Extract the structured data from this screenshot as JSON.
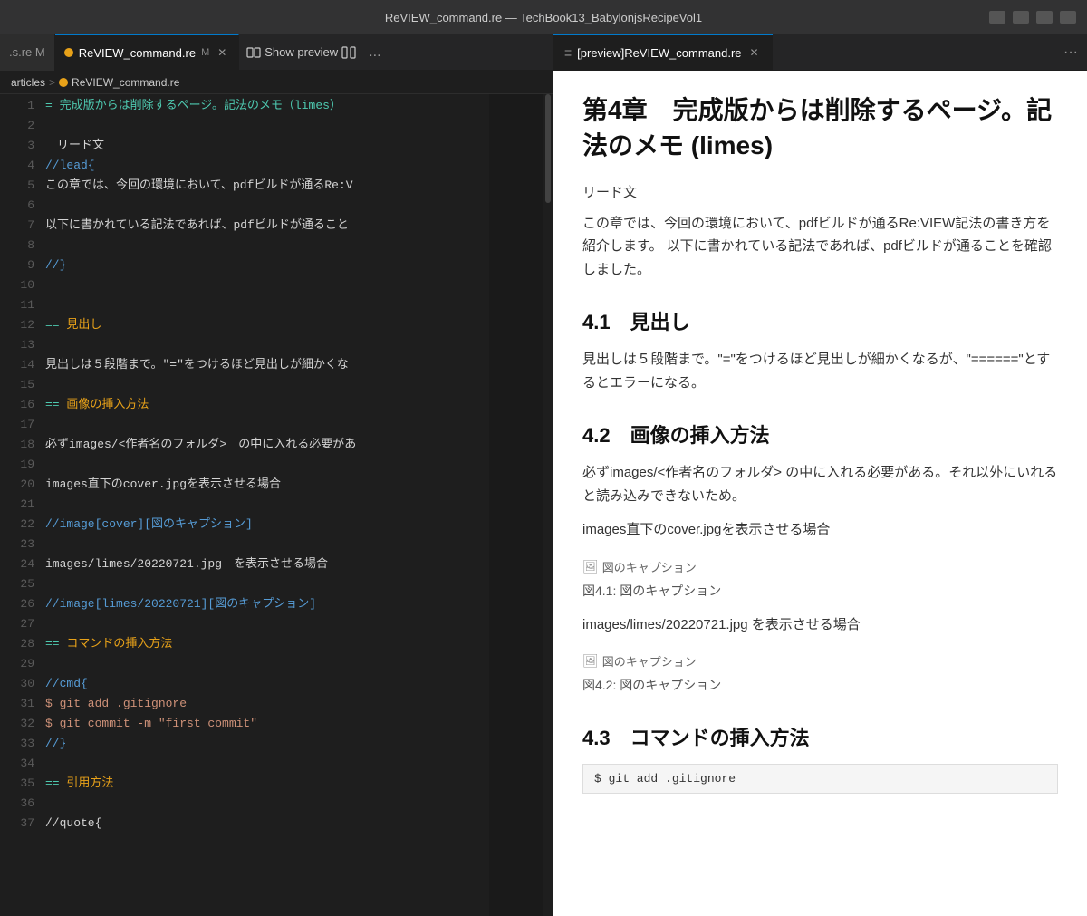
{
  "titleBar": {
    "title": "ReVIEW_command.re — TechBook13_BabylonjsRecipeVol1"
  },
  "tabBar": {
    "tabs": [
      {
        "id": "tab-review-short",
        "label": ".s.re",
        "dot": true,
        "modified": true,
        "active": false,
        "showClose": false
      },
      {
        "id": "tab-review-command",
        "label": "ReVIEW_command.re",
        "dot": true,
        "modified": true,
        "active": true,
        "showClose": true
      }
    ],
    "showPreviewLabel": "Show preview",
    "overflowLabel": "..."
  },
  "breadcrumb": {
    "folder": "articles",
    "separator": ">",
    "filename": "ReVIEW_command.re"
  },
  "editor": {
    "lines": [
      {
        "num": 1,
        "content": "= 完成版からは削除するページ。記法のメモ（limes）",
        "type": "heading"
      },
      {
        "num": 2,
        "content": ""
      },
      {
        "num": 3,
        "content": "　リード文"
      },
      {
        "num": 4,
        "content": "//lead{",
        "type": "keyword"
      },
      {
        "num": 5,
        "content": "この章では、今回の環境において、pdfビルドが通るRe:V"
      },
      {
        "num": 6,
        "content": ""
      },
      {
        "num": 7,
        "content": "以下に書かれている記法であれば、pdfビルドが通ること"
      },
      {
        "num": 8,
        "content": ""
      },
      {
        "num": 9,
        "content": "//}",
        "type": "keyword"
      },
      {
        "num": 10,
        "content": ""
      },
      {
        "num": 11,
        "content": ""
      },
      {
        "num": 12,
        "content": "== 見出し",
        "type": "heading2"
      },
      {
        "num": 13,
        "content": ""
      },
      {
        "num": 14,
        "content": "見出しは５段階まで。\"=\"をつけるほど見出しが細かくな"
      },
      {
        "num": 15,
        "content": ""
      },
      {
        "num": 16,
        "content": "== 画像の挿入方法",
        "type": "heading2"
      },
      {
        "num": 17,
        "content": ""
      },
      {
        "num": 18,
        "content": "必ずimages/<作者名のフォルダ>　の中に入れる必要があ"
      },
      {
        "num": 19,
        "content": ""
      },
      {
        "num": 20,
        "content": "images直下のcover.jpgを表示させる場合"
      },
      {
        "num": 21,
        "content": ""
      },
      {
        "num": 22,
        "content": "//image[cover][図のキャプション]",
        "type": "keyword"
      },
      {
        "num": 23,
        "content": ""
      },
      {
        "num": 24,
        "content": "images/limes/20220721.jpg　を表示させる場合"
      },
      {
        "num": 25,
        "content": ""
      },
      {
        "num": 26,
        "content": "//image[limes/20220721][図のキャプション]",
        "type": "keyword"
      },
      {
        "num": 27,
        "content": ""
      },
      {
        "num": 28,
        "content": "== コマンドの挿入方法",
        "type": "heading2"
      },
      {
        "num": 29,
        "content": ""
      },
      {
        "num": 30,
        "content": "//cmd{",
        "type": "keyword"
      },
      {
        "num": 31,
        "content": "$ git add .gitignore",
        "type": "code"
      },
      {
        "num": 32,
        "content": "$ git commit -m \"first commit\"",
        "type": "code"
      },
      {
        "num": 33,
        "content": "//}",
        "type": "keyword"
      },
      {
        "num": 34,
        "content": ""
      },
      {
        "num": 35,
        "content": "== 引用方法",
        "type": "heading2"
      },
      {
        "num": 36,
        "content": ""
      },
      {
        "num": 37,
        "content": "//quote{"
      }
    ]
  },
  "preview": {
    "tabLabel": "[preview]ReVIEW_command.re",
    "content": {
      "h1": "第4章　完成版からは削除するページ。記法のメモ (limes)",
      "leadLabel": "リード文",
      "para1": "この章では、今回の環境において、pdfビルドが通るRe:VIEW記法の書き方を紹介します。 以下に書かれている記法であれば、pdfビルドが通ることを確認しました。",
      "h2_1": "4.1　見出し",
      "para2": "見出しは５段階まで。\"=\"をつけるほど見出しが細かくなるが、\"======\"とするとエラーになる。",
      "h2_2": "4.2　画像の挿入方法",
      "para3": "必ずimages/<作者名のフォルダ> の中に入れる必要がある。それ以外にいれると読み込みできないため。",
      "para4": "images直下のcover.jpgを表示させる場合",
      "img1_alt": "図のキャプション",
      "fig1": "図4.1: 図のキャプション",
      "para5": "images/limes/20220721.jpg を表示させる場合",
      "img2_alt": "図のキャプション",
      "fig2": "図4.2: 図のキャプション",
      "h2_3": "4.3　コマンドの挿入方法",
      "code1": "$ git add .gitignore"
    }
  }
}
